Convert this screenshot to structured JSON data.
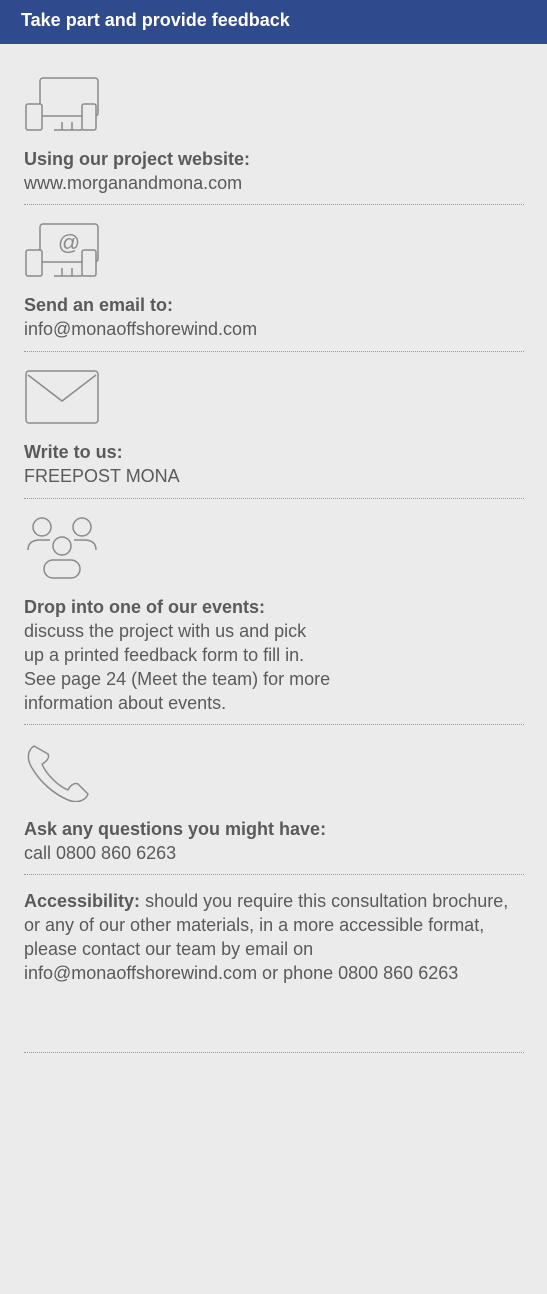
{
  "header": {
    "title": "Take part and provide feedback"
  },
  "colors": {
    "header_bg": "#2f4a8d",
    "panel_bg": "#ebebeb",
    "text": "#5a5a5a",
    "icon": "#8a8a8a"
  },
  "sections": [
    {
      "icon": "devices-icon",
      "heading": "Using our project website:",
      "lines": [
        "www.morganandmona.com"
      ]
    },
    {
      "icon": "email-devices-icon",
      "heading": "Send an email to:",
      "lines": [
        "info@monaoffshorewind.com"
      ]
    },
    {
      "icon": "envelope-icon",
      "heading": "Write to us:",
      "lines": [
        "FREEPOST MONA"
      ]
    },
    {
      "icon": "people-icon",
      "heading": "Drop into one of our events:",
      "lines": [
        "discuss the project with us and pick",
        "up a printed feedback form to fill in.",
        "See page 24 (Meet the team) for more",
        "information about events."
      ]
    },
    {
      "icon": "phone-icon",
      "heading": "Ask any questions you might have:",
      "lines": [
        "call 0800 860 6263"
      ]
    }
  ],
  "accessibility": {
    "label": "Accessibility:",
    "text": " should you require this consultation brochure, or any of our other materials, in a more accessible format, please contact our team by email on info@monaoffshorewind.com or phone 0800 860 6263"
  }
}
